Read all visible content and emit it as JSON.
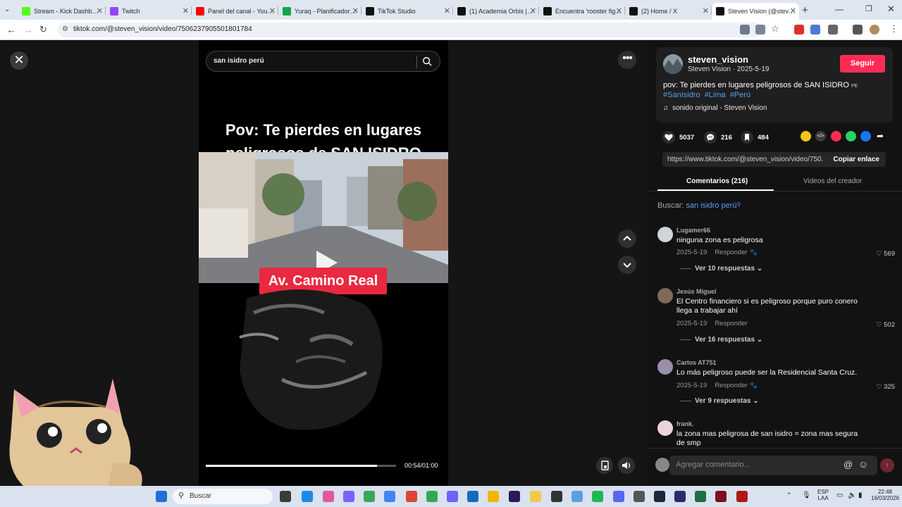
{
  "browser": {
    "tabs": [
      {
        "title": "Stream - Kick Dashb…",
        "favicon": "kick-icon",
        "color": "#53fc18"
      },
      {
        "title": "Twitch",
        "favicon": "twitch-icon",
        "color": "#9146ff"
      },
      {
        "title": "Panel del canal - You…",
        "favicon": "youtube-icon",
        "color": "#ff0000"
      },
      {
        "title": "Yuraq - Planificador…",
        "favicon": "yuraq-icon",
        "color": "#16a34a"
      },
      {
        "title": "TikTok Studio",
        "favicon": "tiktok-icon",
        "color": "#111111"
      },
      {
        "title": "(1) Academia Orbis |…",
        "favicon": "x-icon",
        "color": "#111111"
      },
      {
        "title": "Encuentra 'rooster fig…",
        "favicon": "tiktok-icon",
        "color": "#111111"
      },
      {
        "title": "(2) Home / X",
        "favicon": "x-icon",
        "color": "#111111"
      },
      {
        "title": "Steven Vision (@stev…",
        "favicon": "tiktok-icon",
        "color": "#111111",
        "active": true
      }
    ],
    "url": "tiktok.com/@steven_vision/video/7506237905501801784"
  },
  "video": {
    "search_value": "san isidro perú",
    "title_line1": "Pov: Te pierdes en lugares",
    "title_line2": "peligrosos de SAN ISIDRO",
    "street_label": "Av. Camino Real",
    "time": "00:54/01:00",
    "progress": 0.9
  },
  "info": {
    "username": "steven_vision",
    "subtitle": "Steven Vision · 2025-5-19",
    "follow_label": "Seguir",
    "description": "pov: Te pierdes en lugares peligrosos de SAN ISIDRO",
    "flag": "PE",
    "hashtags": [
      "#SanIsidro",
      "#Lima",
      "#Perú"
    ],
    "music": "sonido original - Steven Vision",
    "likes": "5037",
    "comments_count": "216",
    "saves": "484",
    "link": "https://www.tiktok.com/@steven_vision/video/750...",
    "copy_label": "Copiar enlace"
  },
  "tabs2": {
    "comments": "Comentarios (216)",
    "creator": "Videos del creador"
  },
  "search_label": "Buscar:",
  "search_query": "san isidro perú",
  "comments": [
    {
      "user": "Lugamer66",
      "text": "ninguna zona es peligrosa",
      "date": "2025-5-19",
      "reply": "Responder",
      "likes": "569",
      "replies": "Ver 10 respuestas"
    },
    {
      "user": "Jesús Miguel",
      "text": "El Centro financiero si es peligroso porque puro conero llega a trabajar ahí",
      "date": "2025-5-19",
      "reply": "Responder",
      "likes": "502",
      "replies": "Ver 16 respuestas"
    },
    {
      "user": "Carlos AT751",
      "text": "Lo más peligroso puede ser la Residencial Santa Cruz.",
      "date": "2025-5-19",
      "reply": "Responder",
      "likes": "325",
      "replies": "Ver 9 respuestas"
    },
    {
      "user": "frank.",
      "text": "la zona mas peligrosa de san isidro = zona mas segura de smp"
    }
  ],
  "compose_placeholder": "Agregar comentario...",
  "taskbar": {
    "search": "Buscar",
    "lang1": "ESP",
    "lang2": "LAA",
    "time": "22:48",
    "date": "16/03/2026"
  }
}
